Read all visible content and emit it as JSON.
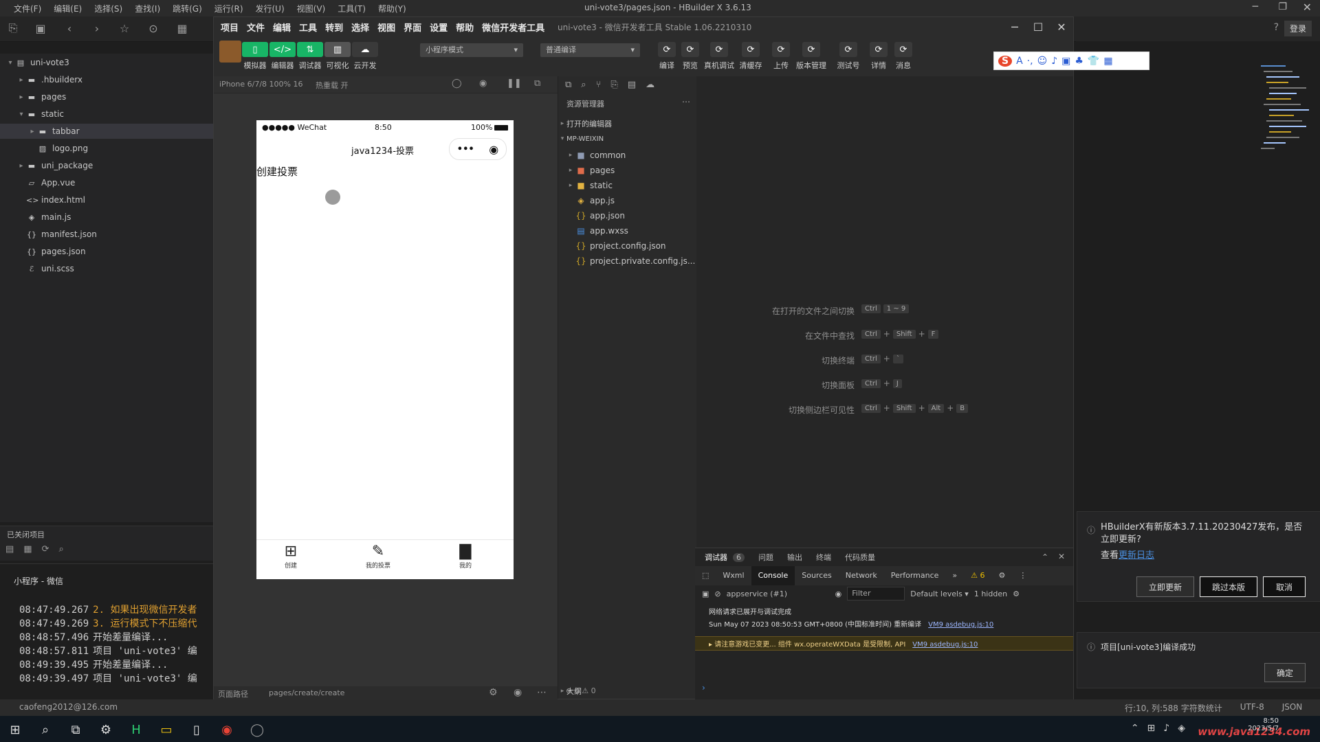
{
  "hbuilder": {
    "title": "uni-vote3/pages.json - HBuilder X 3.6.13",
    "menu": [
      "文件(F)",
      "编辑(E)",
      "选择(S)",
      "查找(I)",
      "跳转(G)",
      "运行(R)",
      "发行(U)",
      "视图(V)",
      "工具(T)",
      "帮助(Y)"
    ],
    "tree": [
      {
        "label": "uni-vote3",
        "icon": "project-icon",
        "depth": 0,
        "open": true
      },
      {
        "label": ".hbuilderx",
        "icon": "folder-icon",
        "depth": 1,
        "open": false
      },
      {
        "label": "pages",
        "icon": "folder-icon",
        "depth": 1,
        "open": false
      },
      {
        "label": "static",
        "icon": "folder-icon",
        "depth": 1,
        "open": true
      },
      {
        "label": "tabbar",
        "icon": "folder-icon",
        "depth": 2,
        "open": false,
        "selected": true
      },
      {
        "label": "logo.png",
        "icon": "image-icon",
        "depth": 2
      },
      {
        "label": "uni_package",
        "icon": "folder-icon",
        "depth": 1,
        "open": false
      },
      {
        "label": "App.vue",
        "icon": "vue-file-icon",
        "depth": 1
      },
      {
        "label": "index.html",
        "icon": "html-file-icon",
        "depth": 1
      },
      {
        "label": "main.js",
        "icon": "js-file-icon",
        "depth": 1
      },
      {
        "label": "manifest.json",
        "icon": "json-file-icon",
        "depth": 1
      },
      {
        "label": "pages.json",
        "icon": "json-file-icon",
        "depth": 1
      },
      {
        "label": "uni.scss",
        "icon": "scss-file-icon",
        "depth": 1
      }
    ],
    "closed_projects_label": "已关闭项目",
    "console_tab": "小程序 - 微信",
    "console_lines": [
      {
        "time": "08:47:49.267",
        "text": "2. 如果出现微信开发者"
      },
      {
        "time": "08:47:49.269",
        "text": "3. 运行模式下不压缩代"
      },
      {
        "time": "08:48:57.496",
        "text": "开始差量编译..."
      },
      {
        "time": "08:48:57.811",
        "text": "项目 'uni-vote3' 编"
      },
      {
        "time": "08:49:39.495",
        "text": "开始差量编译..."
      },
      {
        "time": "08:49:39.497",
        "text": "项目 'uni-vote3' 编"
      }
    ],
    "status_left": "caofeng2012@126.com",
    "status_right": [
      "行:10, 列:588 字符数统计",
      "UTF-8",
      "JSON"
    ],
    "login_label": "登录"
  },
  "devtools": {
    "title": "uni-vote3 - 微信开发者工具 Stable 1.06.2210310",
    "menu": [
      "项目",
      "文件",
      "编辑",
      "工具",
      "转到",
      "选择",
      "视图",
      "界面",
      "设置",
      "帮助",
      "微信开发者工具"
    ],
    "toolbar": [
      {
        "label": "模拟器",
        "icon": "▯",
        "color": "#18b566"
      },
      {
        "label": "编辑器",
        "icon": "</>",
        "color": "#18b566"
      },
      {
        "label": "调试器",
        "icon": "⇅",
        "color": "#18b566"
      },
      {
        "label": "可视化",
        "icon": "▥",
        "color": "#555555"
      },
      {
        "label": "云开发",
        "icon": "☁",
        "color": "#3a3a3a"
      }
    ],
    "mode_select": "小程序模式",
    "compile_select": "普通编译",
    "right_buttons": [
      "编译",
      "预览",
      "真机调试",
      "清缓存",
      "上传",
      "版本管理",
      "测试号",
      "详情",
      "消息"
    ],
    "sim_device": "iPhone 6/7/8 100% 16",
    "sim_hotreload": "热重载 开",
    "sim_path_label": "页面路径",
    "sim_path": "pages/create/create",
    "phone": {
      "status_left": "●●●●● WeChat",
      "status_time": "8:50",
      "status_battery": "100%",
      "nav_title": "java1234-投票",
      "page_text": "创建投票",
      "tabs": [
        {
          "label": "创建",
          "icon": "add-square-icon",
          "glyph": "⊞"
        },
        {
          "label": "我的投票",
          "icon": "vote-icon",
          "glyph": "✎"
        },
        {
          "label": "我的",
          "icon": "profile-icon",
          "glyph": "▇"
        }
      ]
    },
    "file_panel_title": "资源管理器",
    "file_sections": [
      "打开的编辑器",
      "MP-WEIXIN"
    ],
    "files": [
      {
        "label": "common",
        "icon": "folder-icon",
        "type": "folder",
        "color": "#8f9bb3"
      },
      {
        "label": "pages",
        "icon": "folder-icon",
        "type": "folder",
        "color": "#e06c4b"
      },
      {
        "label": "static",
        "icon": "folder-icon",
        "type": "folder",
        "color": "#e3b341"
      },
      {
        "label": "app.js",
        "icon": "js-file-icon",
        "type": "file",
        "color": "#e3b341"
      },
      {
        "label": "app.json",
        "icon": "json-file-icon",
        "type": "file",
        "color": "#c9a227"
      },
      {
        "label": "app.wxss",
        "icon": "wxss-file-icon",
        "type": "file",
        "color": "#4a90e2"
      },
      {
        "label": "project.config.json",
        "icon": "json-file-icon",
        "type": "file",
        "color": "#c9a227"
      },
      {
        "label": "project.private.config.js...",
        "icon": "json-file-icon",
        "type": "file",
        "color": "#c9a227"
      }
    ],
    "outline_label": "大纲",
    "outline_counts": "⊗ 0 ⚠ 0",
    "shortcuts": [
      {
        "label": "在打开的文件之间切换",
        "keys": [
          "Ctrl",
          "1 ~ 9"
        ]
      },
      {
        "label": "在文件中查找",
        "keys": [
          "Ctrl",
          "+",
          "Shift",
          "+",
          "F"
        ]
      },
      {
        "label": "切换终端",
        "keys": [
          "Ctrl",
          "+",
          "`"
        ]
      },
      {
        "label": "切换面板",
        "keys": [
          "Ctrl",
          "+",
          "J"
        ]
      },
      {
        "label": "切换侧边栏可见性",
        "keys": [
          "Ctrl",
          "+",
          "Shift",
          "+",
          "Alt",
          "+",
          "B"
        ]
      }
    ],
    "debugger": {
      "top_tabs": [
        "调试器",
        "问题",
        "输出",
        "终端",
        "代码质量"
      ],
      "top_badge": "6",
      "tabs": [
        "Wxml",
        "Console",
        "Sources",
        "Network",
        "Performance",
        "»"
      ],
      "active_tab": "Console",
      "warn_count": "⚠ 6",
      "context": "appservice (#1)",
      "filter_placeholder": "Filter",
      "levels": "Default levels ▾",
      "hidden": "1 hidden",
      "messages": [
        {
          "kind": "info",
          "text": "网络请求已展开与调试完成",
          "src": ""
        },
        {
          "kind": "info",
          "text": "Sun May 07 2023 08:50:53 GMT+0800 (中国标准时间) 重新编译",
          "src": "VM9 asdebug.js:10"
        },
        {
          "kind": "warn",
          "text": "▸ 请注意游戏已变更... 组件 wx.operateWXData 是受限制, API",
          "src": "VM9 asdebug.js:10"
        }
      ]
    }
  },
  "notifications": {
    "update_text": "HBuilderX有新版本3.7.11.20230427发布，是否立即更新?",
    "update_link_prefix": "查看",
    "update_link": "更新日志",
    "buttons": [
      "立即更新",
      "跳过本版",
      "取消"
    ],
    "compile_text": "项目[uni-vote3]编译成功",
    "compile_button": "确定"
  },
  "ime_icons": [
    "S",
    "A",
    "·,",
    "☺",
    "♪",
    "▣",
    "♣",
    "👕",
    "▦"
  ],
  "taskbar": {
    "icons": [
      "windows-icon",
      "search-icon",
      "task-view-icon",
      "app-icon",
      "hbuilder-icon",
      "explorer-icon",
      "app2-icon",
      "chrome-icon",
      "wechat-devtools-icon"
    ],
    "tray_time": "8:50",
    "tray_date": "2023/5/7",
    "watermark": "www.java1234.com"
  }
}
